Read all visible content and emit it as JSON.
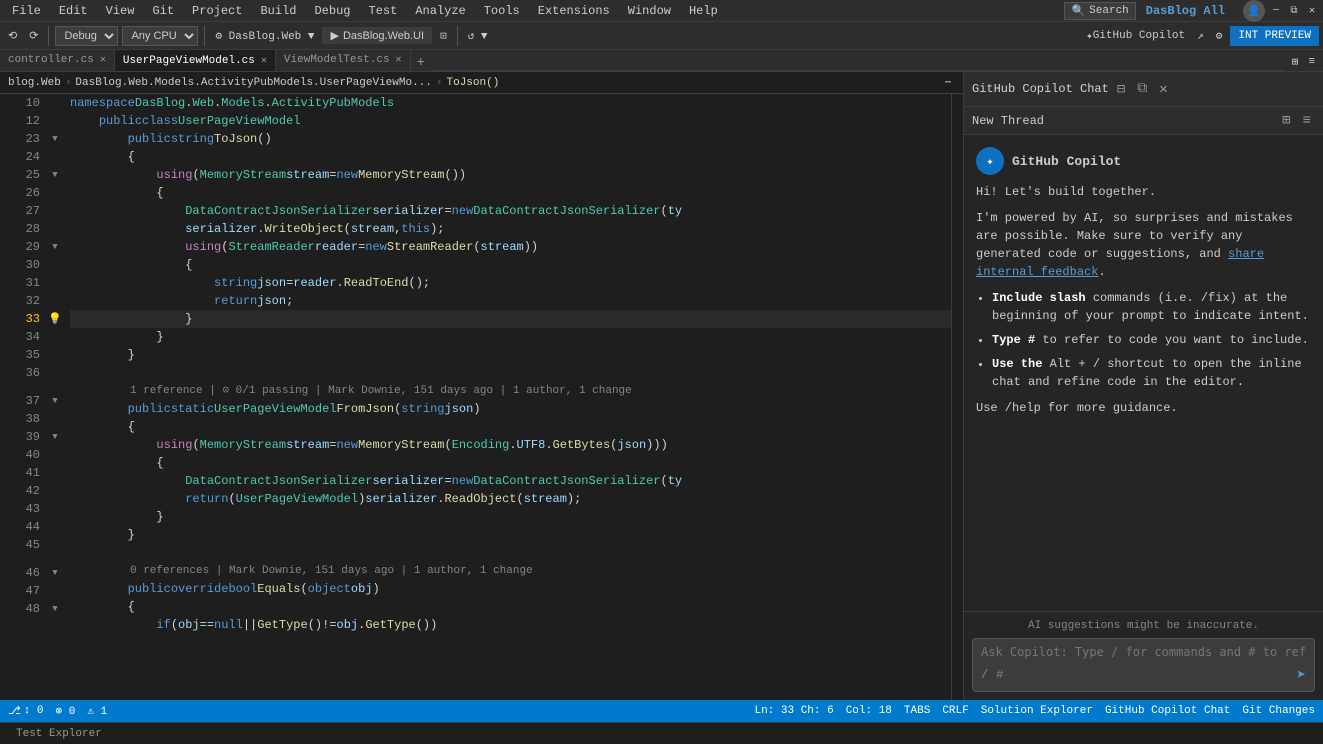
{
  "menu": {
    "items": [
      "File",
      "Edit",
      "View",
      "Git",
      "Project",
      "Build",
      "Debug",
      "Test",
      "Analyze",
      "Tools",
      "Extensions",
      "Window",
      "Help"
    ],
    "search": "Search",
    "brand": "DasBlog All",
    "window_controls": [
      "—",
      "⧉",
      "✕"
    ]
  },
  "toolbar": {
    "debug_config": "Debug",
    "platform": "Any CPU",
    "project": "DasBlog.Web",
    "run_label": "▶ DasBlog.Web.UI",
    "github_copilot": "GitHub Copilot",
    "int_preview": "INT PREVIEW"
  },
  "tabs": [
    {
      "label": "controller.cs",
      "active": false
    },
    {
      "label": "UserPageViewModel.cs",
      "active": true
    },
    {
      "label": "ViewModelTest.cs",
      "active": false
    }
  ],
  "breadcrumb": {
    "project": "blog.Web",
    "namespace": "DasBlog.Web.Models.ActivityPubModels.UserPageViewMo...",
    "method": "ToJson()"
  },
  "code": {
    "lines": [
      {
        "num": 10,
        "content": "namespace DasBlog.Web.Models.ActivityPubModels",
        "indent": 0,
        "fold": false
      },
      {
        "num": 12,
        "content": "    public class UserPageViewModel",
        "indent": 1,
        "fold": false
      },
      {
        "num": 23,
        "content": "        public string ToJson()",
        "indent": 2,
        "fold": true
      },
      {
        "num": 24,
        "content": "        {",
        "indent": 2,
        "fold": false
      },
      {
        "num": 25,
        "content": "            using (MemoryStream stream = new MemoryStream())",
        "indent": 3,
        "fold": true
      },
      {
        "num": 26,
        "content": "            {",
        "indent": 3,
        "fold": false
      },
      {
        "num": 27,
        "content": "                DataContractJsonSerializer serializer = new DataContractJsonSerializer(ty",
        "indent": 4,
        "fold": false
      },
      {
        "num": 28,
        "content": "                serializer.WriteObject(stream, this);",
        "indent": 4,
        "fold": false
      },
      {
        "num": 29,
        "content": "                using (StreamReader reader = new StreamReader(stream))",
        "indent": 4,
        "fold": true
      },
      {
        "num": 30,
        "content": "                {",
        "indent": 4,
        "fold": false
      },
      {
        "num": 31,
        "content": "                    string json = reader.ReadToEnd();",
        "indent": 5,
        "fold": false
      },
      {
        "num": 32,
        "content": "                    return json;",
        "indent": 5,
        "fold": false
      },
      {
        "num": 33,
        "content": "                }",
        "indent": 4,
        "fold": false,
        "active": true,
        "lightbulb": true
      },
      {
        "num": 34,
        "content": "            }",
        "indent": 3,
        "fold": false
      },
      {
        "num": 35,
        "content": "        }",
        "indent": 2,
        "fold": false
      },
      {
        "num": 36,
        "content": "",
        "indent": 0,
        "fold": false
      },
      {
        "num": "meta1",
        "content": "1 reference | ⊙ 0/1 passing | Mark Downie, 151 days ago | 1 author, 1 change",
        "meta": true
      },
      {
        "num": 37,
        "content": "        public static UserPageViewModel FromJson(string json)",
        "indent": 2,
        "fold": true
      },
      {
        "num": 38,
        "content": "        {",
        "indent": 2,
        "fold": false
      },
      {
        "num": 39,
        "content": "            using (MemoryStream stream = new MemoryStream(Encoding.UTF8.GetBytes(json)))",
        "indent": 3,
        "fold": true
      },
      {
        "num": 40,
        "content": "            {",
        "indent": 3,
        "fold": false
      },
      {
        "num": 41,
        "content": "                DataContractJsonSerializer serializer = new DataContractJsonSerializer(ty",
        "indent": 4,
        "fold": false
      },
      {
        "num": 42,
        "content": "                return (UserPageViewModel)serializer.ReadObject(stream);",
        "indent": 4,
        "fold": false
      },
      {
        "num": 43,
        "content": "            }",
        "indent": 3,
        "fold": false
      },
      {
        "num": 44,
        "content": "        }",
        "indent": 2,
        "fold": false
      },
      {
        "num": 45,
        "content": "",
        "indent": 0,
        "fold": false
      },
      {
        "num": "meta2",
        "content": "0 references | Mark Downie, 151 days ago | 1 author, 1 change",
        "meta": true
      },
      {
        "num": 46,
        "content": "        public override bool Equals(object obj)",
        "indent": 2,
        "fold": true
      },
      {
        "num": 47,
        "content": "        {",
        "indent": 2,
        "fold": false
      },
      {
        "num": 48,
        "content": "            if (obj == null || GetType() != obj.GetType())",
        "indent": 3,
        "fold": true
      }
    ]
  },
  "copilot": {
    "title": "GitHub Copilot Chat",
    "new_thread": "New Thread",
    "avatar_text": "✦",
    "agent_name": "GitHub Copilot",
    "greeting": "Hi! Let's build together.",
    "disclaimer": "I'm powered by AI, so surprises and mistakes are possible. Make sure to verify any generated code or suggestions, and",
    "feedback_link": "share internal feedback",
    "bullets": [
      {
        "bold": "Include slash",
        "rest": " commands (i.e. /fix) at the beginning of your prompt to indicate intent."
      },
      {
        "bold": "Type #",
        "rest": " to refer to code you want to include."
      },
      {
        "bold": "Use the",
        "rest": " Alt + / shortcut to open the inline chat and refine code in the editor."
      }
    ],
    "help_text": "Use /help for more guidance.",
    "ai_note": "AI suggestions might be inaccurate.",
    "input_placeholder": "Ask Copilot: Type / for commands and # to reference code.",
    "slash": "/",
    "hash": "#"
  },
  "status": {
    "git": "↕ 0",
    "errors": "⊗ 0",
    "warnings": "⚠ 1",
    "position": "Ln: 33  Ch: 6",
    "col": "Col: 18",
    "tab_size": "TABS",
    "encoding": "CRLF",
    "right_items": [
      "Solution Explorer",
      "GitHub Copilot Chat",
      "Git Changes"
    ]
  },
  "bottom_tab": "Test Explorer"
}
